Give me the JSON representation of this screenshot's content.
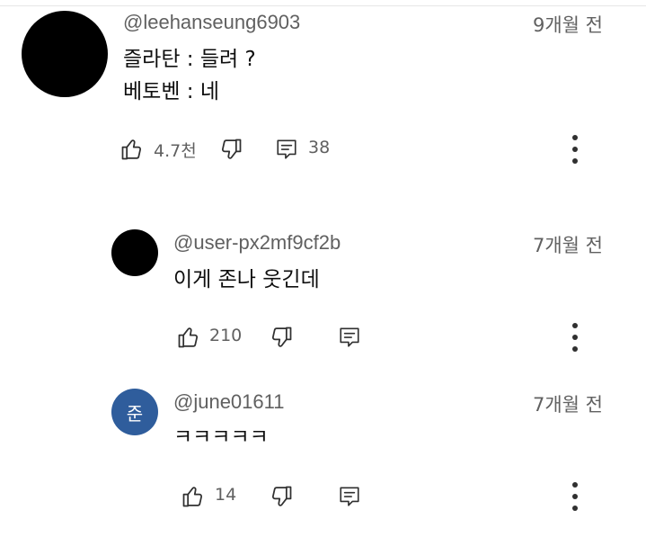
{
  "comments": [
    {
      "author": "@leehanseung6903",
      "time": "9개월 전",
      "lines": [
        "즐라탄 : 들려 ?",
        "베토벤 : 네"
      ],
      "likes": "4.7천",
      "replies": "38",
      "avatar_color": "#000000"
    },
    {
      "author": "@user-px2mf9cf2b",
      "time": "7개월 전",
      "lines": [
        "이게 존나 웃긴데"
      ],
      "likes": "210",
      "avatar_color": "#000000"
    },
    {
      "author": "@june01611",
      "time": "7개월 전",
      "lines": [
        "ㅋㅋㅋㅋㅋ"
      ],
      "likes": "14",
      "avatar_letter": "준",
      "avatar_color": "#2f5d9c"
    }
  ],
  "icons": {
    "like": "thumbs-up-icon",
    "dislike": "thumbs-down-icon",
    "reply": "reply-icon",
    "menu": "more-vert-icon"
  },
  "colors": {
    "secondary_text": "#606060",
    "primary_text": "#0f0f0f",
    "icon": "#303030"
  }
}
